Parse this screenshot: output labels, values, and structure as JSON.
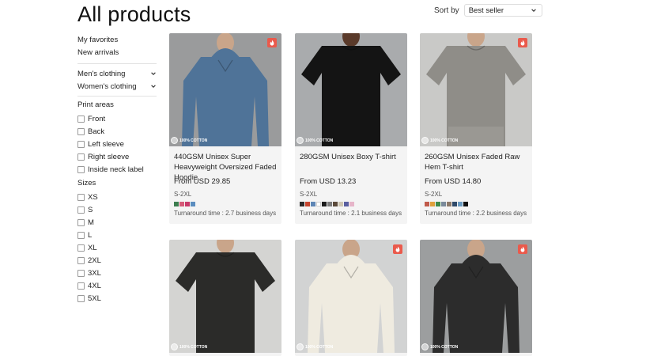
{
  "page": {
    "title": "All products"
  },
  "sort": {
    "label": "Sort by",
    "value": "Best seller"
  },
  "sidebar": {
    "links": [
      "My favorites",
      "New arrivals"
    ],
    "categories": [
      "Men's clothing",
      "Women's clothing"
    ],
    "print_areas_title": "Print areas",
    "print_areas": [
      "Front",
      "Back",
      "Left sleeve",
      "Right sleeve",
      "Inside neck label"
    ],
    "sizes_title": "Sizes",
    "sizes": [
      "XS",
      "S",
      "M",
      "L",
      "XL",
      "2XL",
      "3XL",
      "4XL",
      "5XL"
    ]
  },
  "badge_text": "100% COTTON",
  "products": [
    {
      "title": "440GSM Unisex Super Heavyweight Oversized Faded Hoodie",
      "price": "From USD 29.85",
      "sizes": "S-2XL",
      "turnaround": "Turnaround time : 2.7 business days",
      "hot": true,
      "bg": "#9a9b9c",
      "garment": "#4f7398",
      "swatches": [
        "#3d7d4f",
        "#d65a78",
        "#c83a6a",
        "#5b8dbf"
      ]
    },
    {
      "title": "280GSM Unisex Boxy T-shirt",
      "price": "From USD 13.23",
      "sizes": "S-2XL",
      "turnaround": "Turnaround time : 2.1 business days",
      "hot": false,
      "bg": "#a9abad",
      "garment": "#141414",
      "swatches": [
        "#2a2a2a",
        "#c6452f",
        "#5e86b5",
        "#ffffff",
        "#1b1b1b",
        "#7a7a7a",
        "#5b4a3a",
        "#cfc6b2",
        "#5a5fa0",
        "#e6b5c9"
      ]
    },
    {
      "title": "260GSM Unisex Faded Raw Hem T-shirt",
      "price": "From USD 14.80",
      "sizes": "S-2XL",
      "turnaround": "Turnaround time : 2.2 business days",
      "hot": true,
      "bg": "#c9c9c7",
      "garment": "#8f8d88",
      "swatches": [
        "#c05a4a",
        "#e0a03c",
        "#3f8a4a",
        "#7a8a9a",
        "#8c7a6a",
        "#2f4a6a",
        "#6a9ac0",
        "#111111"
      ]
    },
    {
      "title": "",
      "price": "",
      "sizes": "",
      "turnaround": "",
      "hot": false,
      "bg": "#d4d4d2",
      "garment": "#2b2b29",
      "swatches": []
    },
    {
      "title": "",
      "price": "",
      "sizes": "",
      "turnaround": "",
      "hot": true,
      "bg": "#d2d3d3",
      "garment": "#efebe0",
      "swatches": []
    },
    {
      "title": "",
      "price": "",
      "sizes": "",
      "turnaround": "",
      "hot": true,
      "bg": "#9c9e9f",
      "garment": "#2c2c2c",
      "swatches": []
    }
  ]
}
